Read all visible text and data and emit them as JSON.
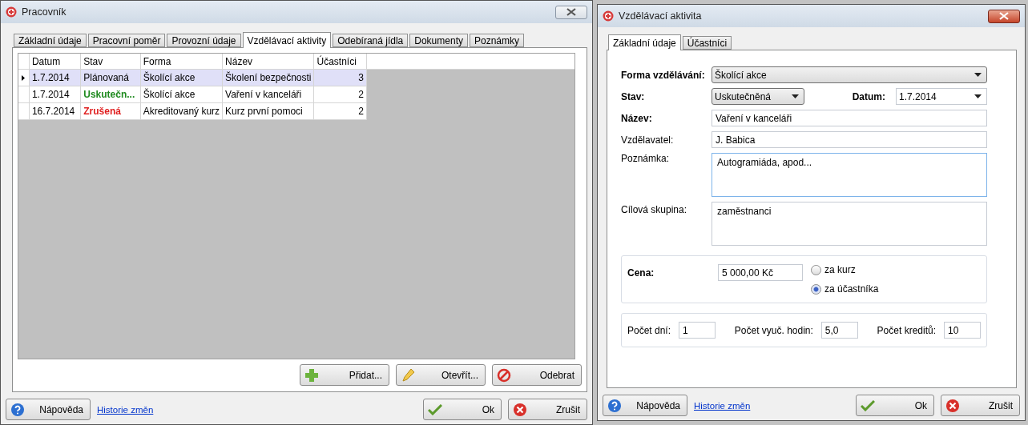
{
  "main_window": {
    "title": "Pracovník",
    "tabs": [
      {
        "label": "Základní údaje",
        "selected": false
      },
      {
        "label": "Pracovní poměr",
        "selected": false
      },
      {
        "label": "Provozní údaje",
        "selected": false
      },
      {
        "label": "Vzdělávací aktivity",
        "selected": true
      },
      {
        "label": "Odebíraná jídla",
        "selected": false
      },
      {
        "label": "Dokumenty",
        "selected": false
      },
      {
        "label": "Poznámky",
        "selected": false
      }
    ],
    "table": {
      "columns": [
        "Datum",
        "Stav",
        "Forma",
        "Název",
        "Účastníci"
      ],
      "rows": [
        {
          "selected": true,
          "kind": "planned",
          "cells": [
            "1.7.2014",
            "Plánovaná",
            "Školící akce",
            "Školení bezpečnosti",
            "3"
          ]
        },
        {
          "selected": false,
          "kind": "done",
          "cells": [
            "1.7.2014",
            "Uskutečn...",
            "Školící akce",
            "Vaření v kanceláři",
            "2"
          ]
        },
        {
          "selected": false,
          "kind": "cancelled",
          "cells": [
            "16.7.2014",
            "Zrušená",
            "Akreditovaný kurz",
            "Kurz první pomoci",
            "2"
          ]
        }
      ]
    },
    "actions": [
      {
        "kind": "add",
        "label": "Přidat..."
      },
      {
        "kind": "edit",
        "label": "Otevřít..."
      },
      {
        "kind": "remove",
        "label": "Odebrat"
      }
    ],
    "help_button": "Nápověda",
    "history_link": "Historie změn",
    "ok_button": "Ok",
    "cancel_button": "Zrušit"
  },
  "dialog": {
    "title": "Vzdělávací aktivita",
    "tabs": [
      {
        "label": "Základní údaje",
        "selected": true
      },
      {
        "label": "Účastníci",
        "selected": false
      }
    ],
    "form_label": "Forma vzdělávání:",
    "form_value": "Školící akce",
    "status_label": "Stav:",
    "status_value": "Uskutečněná",
    "date_label": "Datum:",
    "date_value": "1.7.2014",
    "name_label": "Název:",
    "name_value": "Vaření v kanceláři",
    "teacher_label": "Vzdělavatel:",
    "teacher_value": "J. Babica",
    "note_label": "Poznámka:",
    "note_value": "Autogramiáda, apod...",
    "target_label": "Cílová skupina:",
    "target_value": "zaměstnanci",
    "price_label": "Cena:",
    "price_value": "5 000,00 Kč",
    "price_options": [
      {
        "label": "za kurz",
        "selected": false
      },
      {
        "label": "za účastníka",
        "selected": true
      }
    ],
    "counts": [
      {
        "label": "Počet dní:",
        "value": "1"
      },
      {
        "label": "Počet vyuč. hodin:",
        "value": "5,0"
      },
      {
        "label": "Počet kreditů:",
        "value": "10"
      }
    ],
    "help_button": "Nápověda",
    "history_link": "Historie změn",
    "ok_button": "Ok",
    "cancel_button": "Zrušit"
  }
}
